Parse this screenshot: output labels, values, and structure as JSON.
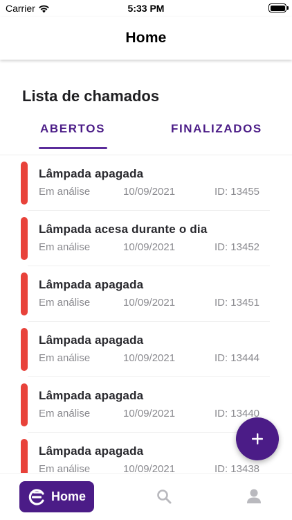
{
  "status_bar": {
    "carrier": "Carrier",
    "time": "5:33 PM"
  },
  "header": {
    "title": "Home"
  },
  "main": {
    "title": "Lista de chamados",
    "tabs": [
      {
        "label": "ABERTOS",
        "active": true
      },
      {
        "label": "FINALIZADOS",
        "active": false
      }
    ],
    "tickets": [
      {
        "title": "Lâmpada apagada",
        "status": "Em análise",
        "date": "10/09/2021",
        "id": "ID: 13455"
      },
      {
        "title": "Lâmpada acesa durante o dia",
        "status": "Em análise",
        "date": "10/09/2021",
        "id": "ID: 13452"
      },
      {
        "title": "Lâmpada apagada",
        "status": "Em análise",
        "date": "10/09/2021",
        "id": "ID: 13451"
      },
      {
        "title": "Lâmpada apagada",
        "status": "Em análise",
        "date": "10/09/2021",
        "id": "ID: 13444"
      },
      {
        "title": "Lâmpada apagada",
        "status": "Em análise",
        "date": "10/09/2021",
        "id": "ID: 13440"
      },
      {
        "title": "Lâmpada apagada",
        "status": "Em análise",
        "date": "10/09/2021",
        "id": "ID: 13438"
      }
    ]
  },
  "fab": {
    "icon": "plus-icon"
  },
  "bottom_nav": {
    "home_label": "Home",
    "items": [
      {
        "icon": "logo-icon",
        "label": "Home",
        "active": true
      },
      {
        "icon": "search-icon",
        "active": false
      },
      {
        "icon": "user-icon",
        "active": false
      }
    ]
  },
  "colors": {
    "primary": "#4b1c87",
    "status_accent": "#e8423a",
    "muted_text": "#8a8a8f"
  }
}
